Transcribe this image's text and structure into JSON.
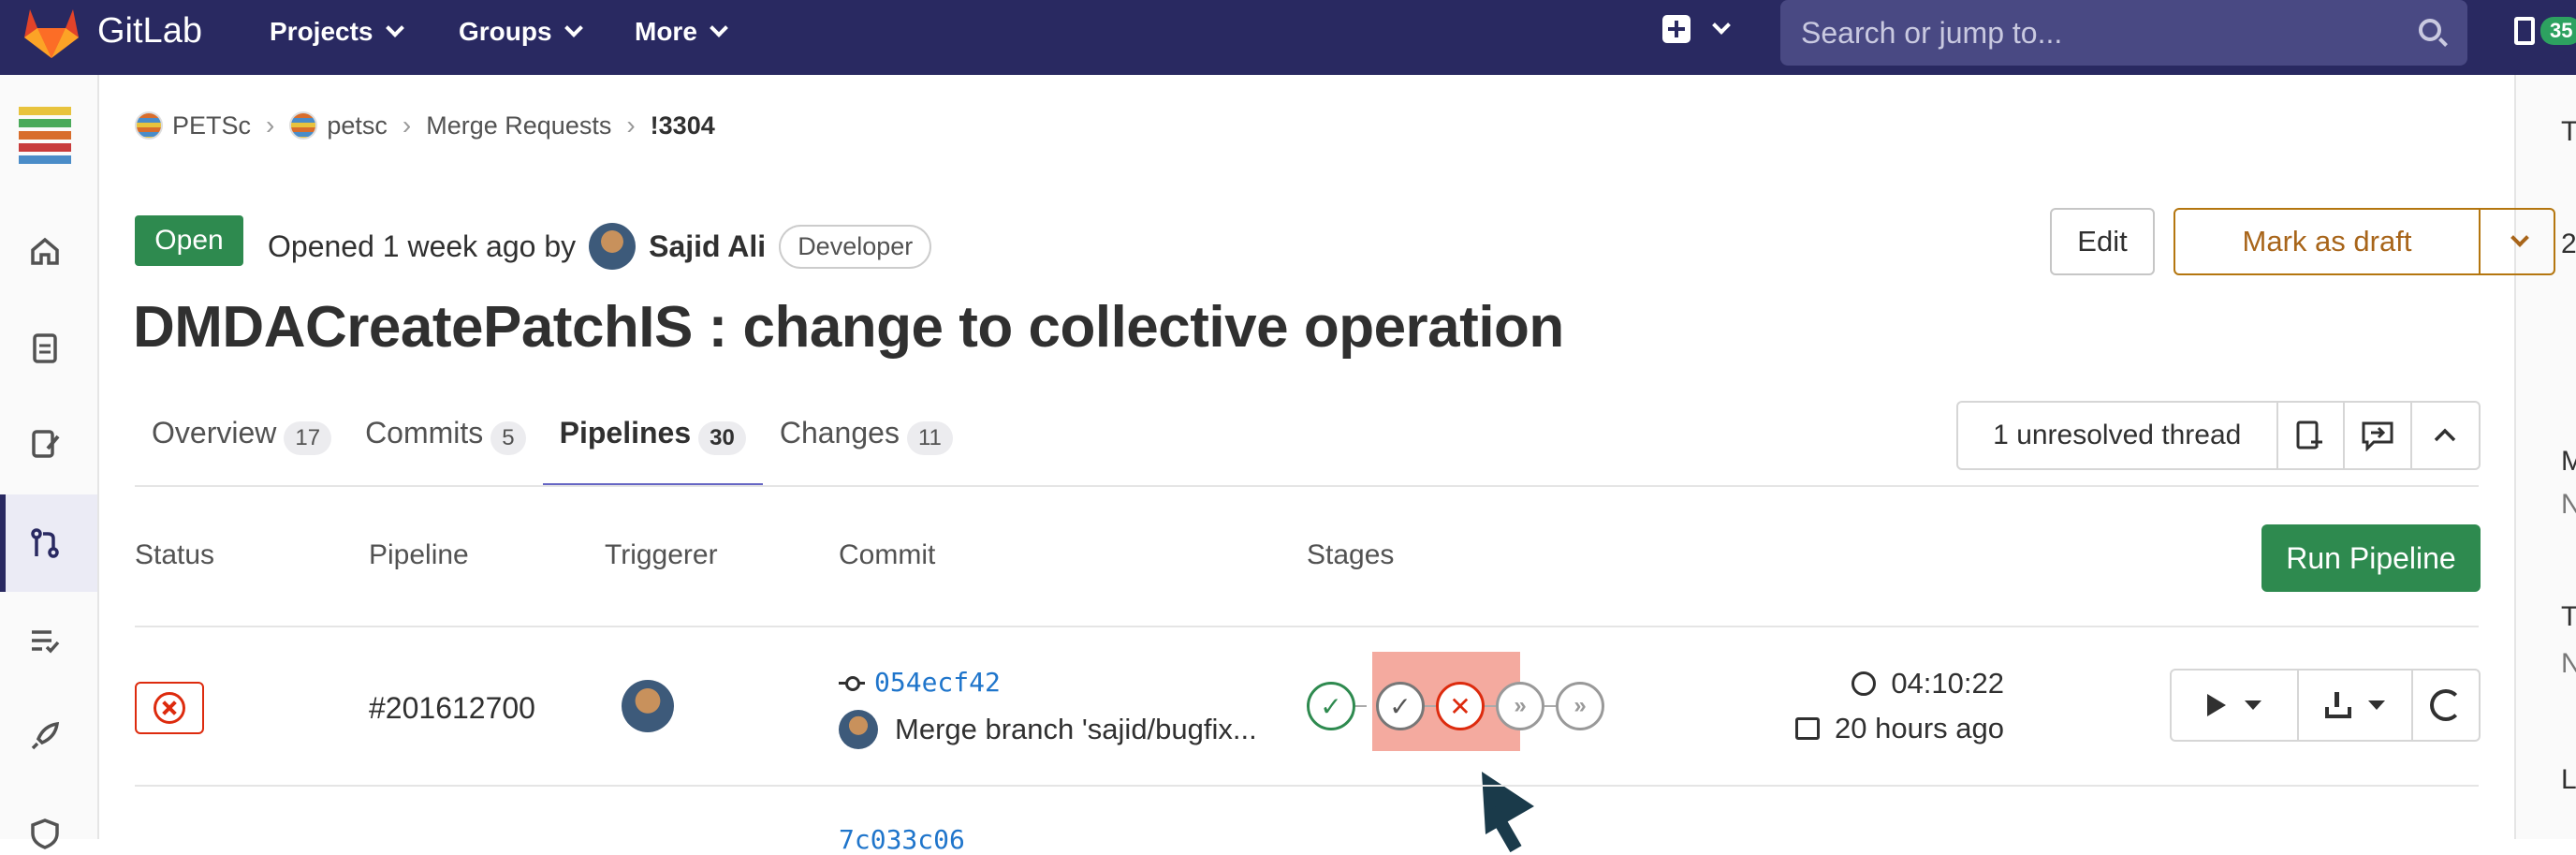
{
  "navbar": {
    "brand": "GitLab",
    "menus": [
      "Projects",
      "Groups",
      "More"
    ],
    "search_placeholder": "Search or jump to...",
    "mr_count": "35"
  },
  "breadcrumb": [
    "PETSc",
    "petsc",
    "Merge Requests",
    "!3304"
  ],
  "mr": {
    "status": "Open",
    "opened_text": "Opened 1 week ago by",
    "author": "Sajid Ali",
    "role": "Developer",
    "title": "DMDACreatePatchIS : change to collective operation",
    "edit_label": "Edit",
    "draft_label": "Mark as draft"
  },
  "tabs": [
    {
      "label": "Overview",
      "count": "17"
    },
    {
      "label": "Commits",
      "count": "5"
    },
    {
      "label": "Pipelines",
      "count": "30"
    },
    {
      "label": "Changes",
      "count": "11"
    }
  ],
  "threads_label": "1 unresolved thread",
  "table": {
    "headers": [
      "Status",
      "Pipeline",
      "Triggerer",
      "Commit",
      "Stages"
    ],
    "run_label": "Run Pipeline",
    "rows": [
      {
        "status": "failed",
        "pipeline": "#201612700",
        "sha": "054ecf42",
        "message": "Merge branch 'sajid/bugfix...",
        "duration": "04:10:22",
        "finished": "20 hours ago"
      }
    ],
    "next_sha_partial": "7c033c06"
  },
  "right_sidebar_letters": [
    "T",
    "2",
    "M",
    "N",
    "T",
    "N",
    "L"
  ],
  "colors": {
    "navbar": "#292961",
    "success": "#2e8a4f",
    "danger": "#dd2b0e",
    "warning": "#a8651a"
  }
}
